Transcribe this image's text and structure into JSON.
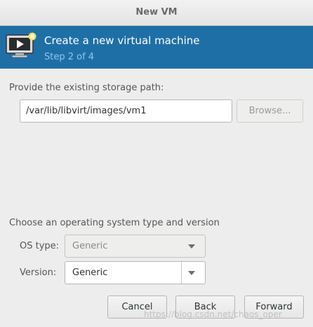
{
  "window": {
    "title": "New VM"
  },
  "banner": {
    "heading": "Create a new virtual machine",
    "step": "Step 2 of 4",
    "icon": "monitor-play-icon"
  },
  "storage": {
    "label": "Provide the existing storage path:",
    "path_value": "/var/lib/libvirt/images/vm1",
    "browse_label": "Browse..."
  },
  "os": {
    "label": "Choose an operating system type and version",
    "type_label": "OS type:",
    "type_value": "Generic",
    "version_label": "Version:",
    "version_value": "Generic"
  },
  "buttons": {
    "cancel": "Cancel",
    "back": "Back",
    "forward": "Forward"
  },
  "watermark": "https://blog.csdn.net/chaos_oper",
  "colors": {
    "banner_bg": "#1f6fa7",
    "step_text": "#8ec7ee",
    "window_bg": "#ededed"
  }
}
